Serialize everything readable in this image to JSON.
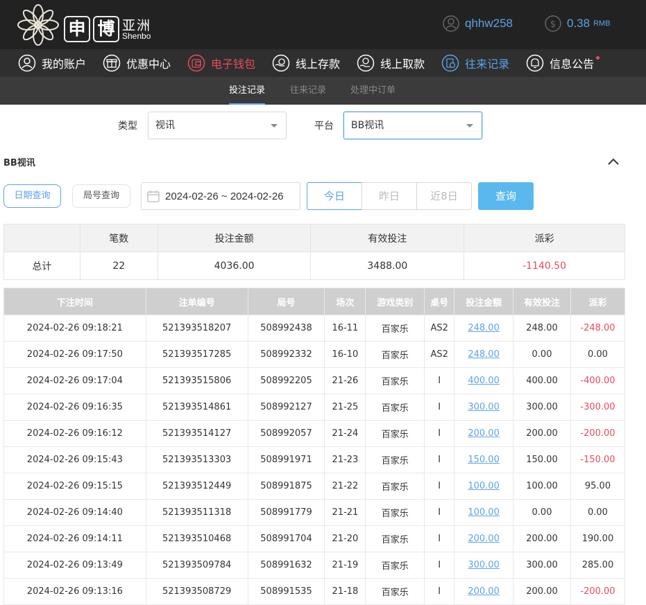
{
  "brand": {
    "char1": "申",
    "char2": "博",
    "cn": "亚洲",
    "en": "Shenbo"
  },
  "user": {
    "username": "qhhw258",
    "balance": "0.38",
    "currency": "RMB",
    "icon": "user-icon",
    "balance_icon": "dollar-icon"
  },
  "main_nav": [
    {
      "label": "我的账户",
      "icon": "user-icon"
    },
    {
      "label": "优惠中心",
      "icon": "gift-icon"
    },
    {
      "label": "电子钱包",
      "icon": "wallet-icon"
    },
    {
      "label": "线上存款",
      "icon": "deposit-icon"
    },
    {
      "label": "线上取款",
      "icon": "withdraw-icon"
    },
    {
      "label": "往来记录",
      "icon": "records-icon"
    },
    {
      "label": "信息公告",
      "icon": "bell-icon"
    }
  ],
  "sub_nav": [
    "投注记录",
    "往来记录",
    "处理中订单"
  ],
  "filters": {
    "type_label": "类型",
    "type_value": "视讯",
    "platform_label": "平台",
    "platform_value": "BB视讯"
  },
  "section_title": "BB视讯",
  "query_modes": {
    "date": "日期查询",
    "round": "局号查询"
  },
  "date_range": "2024-02-26 ~ 2024-02-26",
  "quick_ranges": [
    "今日",
    "昨日",
    "近8日"
  ],
  "query_button": "查询",
  "summary": {
    "headers": [
      "",
      "笔数",
      "投注金额",
      "有效投注",
      "派彩"
    ],
    "row": {
      "label": "总计",
      "count": "22",
      "bet": "4036.00",
      "valid": "3488.00",
      "payout": "-1140.50"
    }
  },
  "records": {
    "headers": [
      "下注时间",
      "注单编号",
      "局号",
      "场次",
      "游戏类别",
      "桌号",
      "投注金额",
      "有效投注",
      "派彩"
    ],
    "rows": [
      [
        "2024-02-26 09:18:21",
        "521393518207",
        "508992438",
        "16-11",
        "百家乐",
        "AS2",
        "248.00",
        "248.00",
        "-248.00"
      ],
      [
        "2024-02-26 09:17:50",
        "521393517285",
        "508992332",
        "16-10",
        "百家乐",
        "AS2",
        "248.00",
        "0.00",
        "0.00"
      ],
      [
        "2024-02-26 09:17:04",
        "521393515806",
        "508992205",
        "21-26",
        "百家乐",
        "I",
        "400.00",
        "400.00",
        "-400.00"
      ],
      [
        "2024-02-26 09:16:35",
        "521393514861",
        "508992127",
        "21-25",
        "百家乐",
        "I",
        "300.00",
        "300.00",
        "-300.00"
      ],
      [
        "2024-02-26 09:16:12",
        "521393514127",
        "508992057",
        "21-24",
        "百家乐",
        "I",
        "200.00",
        "200.00",
        "-200.00"
      ],
      [
        "2024-02-26 09:15:43",
        "521393513303",
        "508991971",
        "21-23",
        "百家乐",
        "I",
        "150.00",
        "150.00",
        "-150.00"
      ],
      [
        "2024-02-26 09:15:15",
        "521393512449",
        "508991875",
        "21-22",
        "百家乐",
        "I",
        "100.00",
        "100.00",
        "95.00"
      ],
      [
        "2024-02-26 09:14:40",
        "521393511318",
        "508991779",
        "21-21",
        "百家乐",
        "I",
        "100.00",
        "0.00",
        "0.00"
      ],
      [
        "2024-02-26 09:14:11",
        "521393510468",
        "508991704",
        "21-20",
        "百家乐",
        "I",
        "200.00",
        "200.00",
        "190.00"
      ],
      [
        "2024-02-26 09:13:49",
        "521393509784",
        "508991632",
        "21-19",
        "百家乐",
        "I",
        "300.00",
        "300.00",
        "285.00"
      ],
      [
        "2024-02-26 09:13:16",
        "521393508729",
        "508991535",
        "21-18",
        "百家乐",
        "I",
        "200.00",
        "200.00",
        "-200.00"
      ]
    ]
  },
  "colors": {
    "accent": "#5ba3e6",
    "negative": "#e64c5c",
    "header_bg": "#222222"
  }
}
